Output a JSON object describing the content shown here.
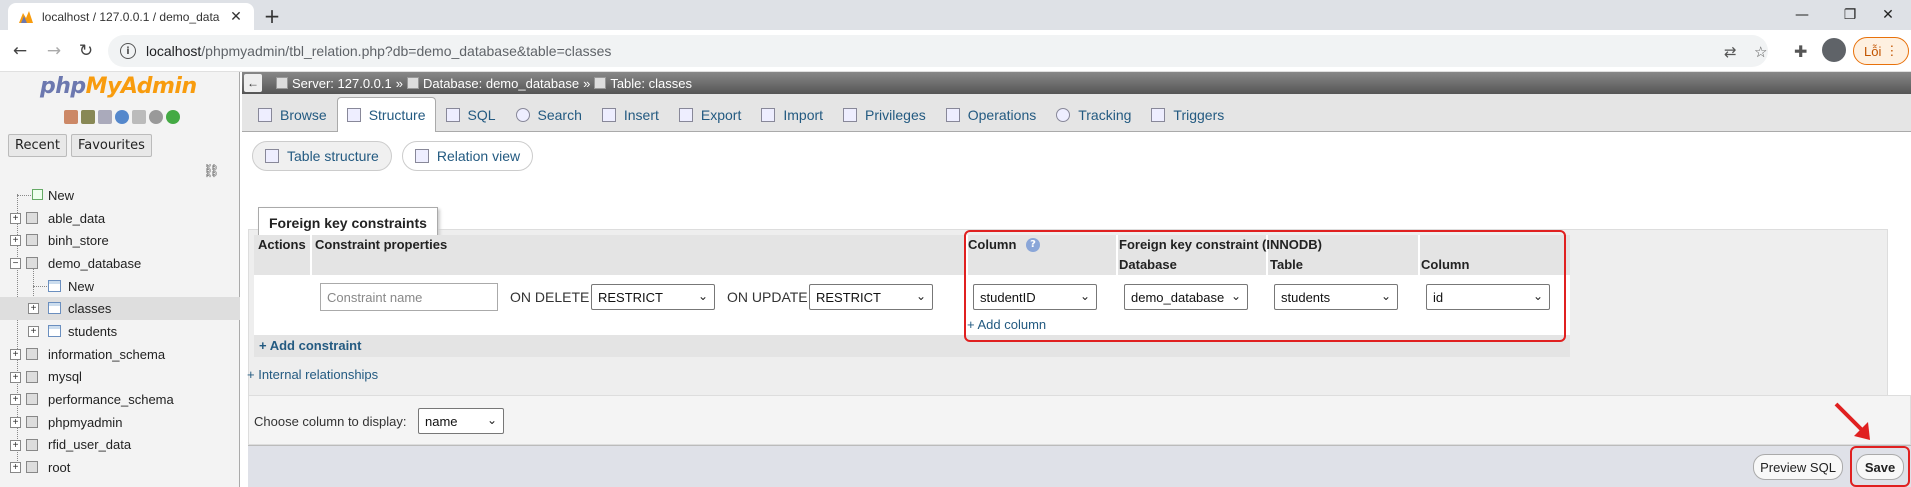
{
  "browser": {
    "tab_title": "localhost / 127.0.0.1 / demo_database",
    "new_tab": "+",
    "url_host": "localhost",
    "url_path": "/phpmyadmin/tbl_relation.php?db=demo_database&table=classes",
    "error_button": "Lỗi"
  },
  "sidebar": {
    "logo_php": "php",
    "logo_myadmin": "MyAdmin",
    "tabs": [
      "Recent",
      "Favourites"
    ],
    "tree": [
      {
        "label": "New",
        "level": 0,
        "kind": "new"
      },
      {
        "label": "able_data",
        "level": 0,
        "kind": "db"
      },
      {
        "label": "binh_store",
        "level": 0,
        "kind": "db"
      },
      {
        "label": "demo_database",
        "level": 0,
        "kind": "db-open"
      },
      {
        "label": "New",
        "level": 1,
        "kind": "new"
      },
      {
        "label": "classes",
        "level": 1,
        "kind": "table",
        "selected": true
      },
      {
        "label": "students",
        "level": 1,
        "kind": "table"
      },
      {
        "label": "information_schema",
        "level": 0,
        "kind": "db"
      },
      {
        "label": "mysql",
        "level": 0,
        "kind": "db"
      },
      {
        "label": "performance_schema",
        "level": 0,
        "kind": "db"
      },
      {
        "label": "phpmyadmin",
        "level": 0,
        "kind": "db"
      },
      {
        "label": "rfid_user_data",
        "level": 0,
        "kind": "db"
      },
      {
        "label": "root",
        "level": 0,
        "kind": "db"
      }
    ]
  },
  "breadcrumb": {
    "server": "Server: 127.0.0.1",
    "database": "Database: demo_database",
    "table": "Table: classes"
  },
  "menu_tabs": [
    "Browse",
    "Structure",
    "SQL",
    "Search",
    "Insert",
    "Export",
    "Import",
    "Privileges",
    "Operations",
    "Tracking",
    "Triggers"
  ],
  "active_menu_tab": "Structure",
  "sub_tabs": [
    "Table structure",
    "Relation view"
  ],
  "fk": {
    "legend": "Foreign key constraints",
    "headers": {
      "actions": "Actions",
      "constraint_properties": "Constraint properties",
      "column": "Column",
      "fk_constraint": "Foreign key constraint (INNODB)",
      "database": "Database",
      "table": "Table",
      "ref_column": "Column"
    },
    "constraint_name_placeholder": "Constraint name",
    "on_delete_label": "ON DELETE",
    "on_delete_value": "RESTRICT",
    "on_update_label": "ON UPDATE",
    "on_update_value": "RESTRICT",
    "column_value": "studentID",
    "database_value": "demo_database",
    "table_value": "students",
    "ref_column_value": "id",
    "add_column": "+ Add column",
    "add_constraint": "+ Add constraint"
  },
  "internal_relationships": "+ Internal relationships",
  "display": {
    "label": "Choose column to display:",
    "value": "name"
  },
  "footer": {
    "preview_sql": "Preview SQL",
    "save": "Save"
  },
  "annotation_color": "#e02020"
}
